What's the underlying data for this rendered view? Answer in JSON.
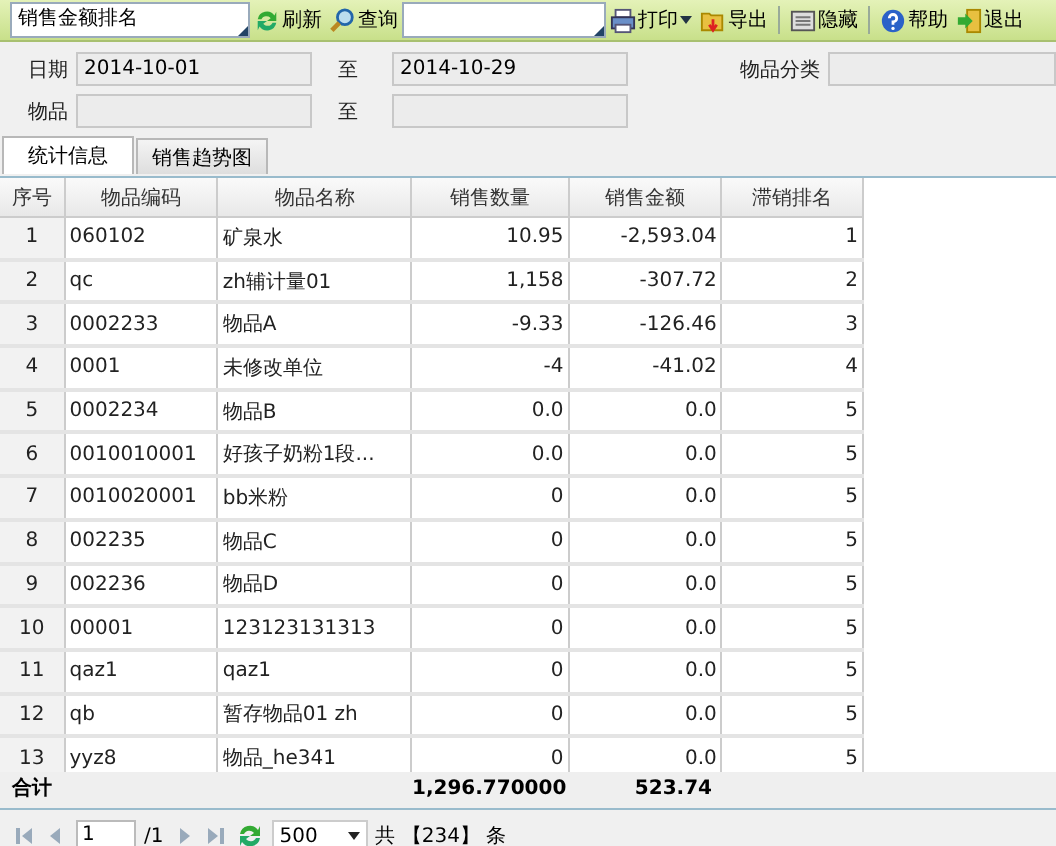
{
  "toolbar": {
    "report_select": {
      "value": "销售金额排名"
    },
    "buttons": [
      {
        "kind": "refresh",
        "label": "刷新"
      },
      {
        "kind": "query",
        "label": "查询"
      },
      {
        "kind": "print",
        "label": "打印",
        "dropdown": true
      },
      {
        "kind": "export",
        "label": "导出"
      },
      {
        "kind": "hide",
        "label": "隐藏"
      },
      {
        "kind": "help",
        "label": "帮助"
      },
      {
        "kind": "exit",
        "label": "退出"
      }
    ]
  },
  "filters": {
    "date_label": "日期",
    "date_from": "2014-10-01",
    "date_to_label": "至",
    "date_to": "2014-10-29",
    "category_label": "物品分类",
    "item_label": "物品",
    "item_to_label": "至"
  },
  "tabs": [
    {
      "label": "统计信息",
      "selected": true
    },
    {
      "label": "销售趋势图",
      "selected": false
    }
  ],
  "table": {
    "columns": [
      "序号",
      "物品编码",
      "物品名称",
      "销售数量",
      "销售金额",
      "滞销排名"
    ],
    "rows": [
      [
        "1",
        "060102",
        "矿泉水",
        "10.95",
        "-2,593.04",
        "1"
      ],
      [
        "2",
        "qc",
        "zh辅计量01",
        "1,158",
        "-307.72",
        "2"
      ],
      [
        "3",
        "0002233",
        "物品A",
        "-9.33",
        "-126.46",
        "3"
      ],
      [
        "4",
        "0001",
        "未修改单位",
        "-4",
        "-41.02",
        "4"
      ],
      [
        "5",
        "0002234",
        "物品B",
        "0.0",
        "0.0",
        "5"
      ],
      [
        "6",
        "0010010001",
        "好孩子奶粉1段...",
        "0.0",
        "0.0",
        "5"
      ],
      [
        "7",
        "0010020001",
        "bb米粉",
        "0",
        "0.0",
        "5"
      ],
      [
        "8",
        "002235",
        "物品C",
        "0",
        "0.0",
        "5"
      ],
      [
        "9",
        "002236",
        "物品D",
        "0",
        "0.0",
        "5"
      ],
      [
        "10",
        "00001",
        "123123131313",
        "0",
        "0.0",
        "5"
      ],
      [
        "11",
        "qaz1",
        "qaz1",
        "0",
        "0.0",
        "5"
      ],
      [
        "12",
        "qb",
        "暂存物品01 zh",
        "0",
        "0.0",
        "5"
      ],
      [
        "13",
        "yyz8",
        "物品_he341",
        "0",
        "0.0",
        "5"
      ]
    ],
    "footer": {
      "label": "合计",
      "quantity": "1,296.770000",
      "amount": "523.74"
    }
  },
  "pager": {
    "page": "1",
    "page_total": "/1",
    "page_size": "500",
    "total_prefix": "共",
    "total": "【234】",
    "total_suffix": "条"
  }
}
